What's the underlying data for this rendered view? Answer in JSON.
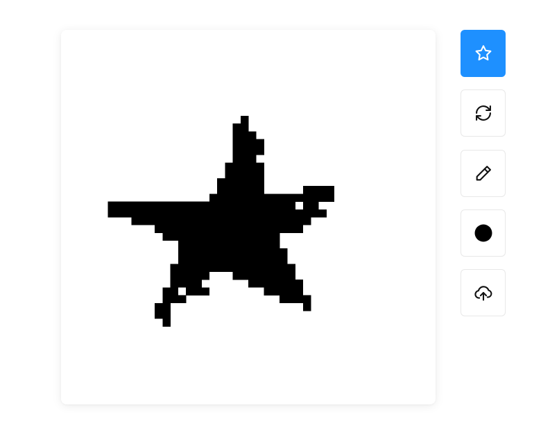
{
  "canvas": {
    "grid_cols": 48,
    "grid_rows": 48,
    "background": "#ffffff",
    "ink": "#000000",
    "drawing_subject": "star"
  },
  "toolbar": {
    "accent": "#1e90ff",
    "tools": [
      {
        "id": "star-stamp",
        "icon": "star-icon",
        "active": true
      },
      {
        "id": "refresh",
        "icon": "refresh-icon",
        "active": false
      },
      {
        "id": "pencil",
        "icon": "pencil-icon",
        "active": false
      },
      {
        "id": "brush-color",
        "icon": "filled-circle-icon",
        "active": false,
        "color": "#000000"
      },
      {
        "id": "upload",
        "icon": "upload-cloud-icon",
        "active": false
      }
    ]
  }
}
